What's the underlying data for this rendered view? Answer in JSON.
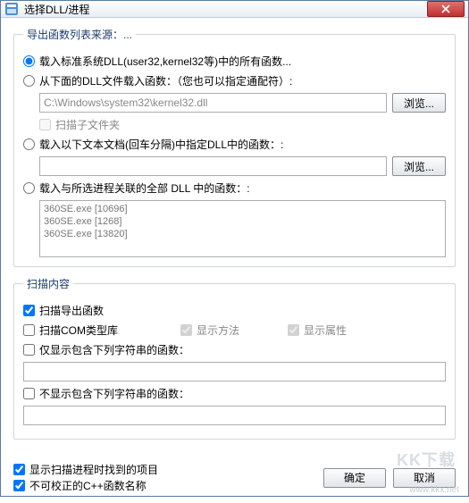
{
  "title": "选择DLL/进程",
  "group1": {
    "legend": "导出函数列表来源：...",
    "opt1": "载入标准系统DLL(user32,kernel32等)中的所有函数...",
    "opt2": "从下面的DLL文件载入函数：（您也可以指定通配符）:",
    "path": "C:\\Windows\\system32\\kernel32.dll",
    "browse": "浏览...",
    "scanSub": "扫描子文件夹",
    "opt3": "载入以下文本文档(回车分隔)中指定DLL中的函数：:",
    "path2": "",
    "opt4": "载入与所选进程关联的全部 DLL 中的函数：:",
    "processes": [
      "360SE.exe  [10696]",
      "360SE.exe  [1268]",
      "360SE.exe  [13820]"
    ]
  },
  "group2": {
    "legend": "扫描内容",
    "scanExport": "扫描导出函数",
    "scanCom": "扫描COM类型库",
    "showMethod": "显示方法",
    "showProp": "显示属性",
    "onlyShow": "仅显示包含下列字符串的函数：",
    "notShow": "不显示包含下列字符串的函数："
  },
  "footer": {
    "showFound": "显示扫描进程时找到的项目",
    "noFix": "不可校正的C++函数名称",
    "ok": "确定",
    "cancel": "取消"
  },
  "watermark": "KK下载",
  "url": "www.kkx.net"
}
